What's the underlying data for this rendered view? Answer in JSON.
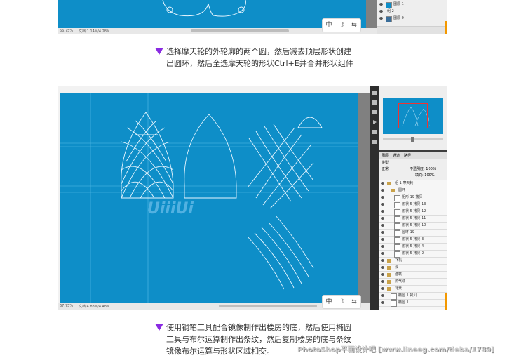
{
  "top_screenshot": {
    "status_left": "66.75%",
    "status_doc": "文档:1.14M/4.28M",
    "layers": [
      {
        "name": "图层 1"
      },
      {
        "name": "组 2"
      },
      {
        "name": "图层 0"
      }
    ],
    "tray": {
      "btn1": "中",
      "btn2": "☽",
      "btn3": "⇆"
    }
  },
  "caption1": {
    "line1": "选择摩天轮的外轮廓的两个圆，然后减去顶层形状创建",
    "line2": "出圆环，然后全选摩天轮的形状Ctrl+E并合并形状组件"
  },
  "bottom_screenshot": {
    "status_left": "67.75%",
    "status_doc": "文档:4.83M/4.48M",
    "canvas_logo": "UiiiUi",
    "panel_tabs": [
      "图层",
      "通道",
      "路径"
    ],
    "panel_kind": "类型",
    "panel_mode": "正常",
    "panel_opacity": "不透明度: 100%",
    "panel_fill": "填充: 100%",
    "layers": [
      {
        "name": "组 1 摩天轮"
      },
      {
        "name": "圆环"
      },
      {
        "name": "矩形 19 拷贝"
      },
      {
        "name": "形状 5 拷贝 13"
      },
      {
        "name": "形状 5 拷贝 12"
      },
      {
        "name": "形状 5 拷贝 11"
      },
      {
        "name": "形状 5 拷贝 10"
      },
      {
        "name": "圆环 19"
      },
      {
        "name": "形状 5 拷贝 3"
      },
      {
        "name": "形状 5 拷贝 4"
      },
      {
        "name": "形状 5 拷贝 2"
      },
      {
        "name": "飞机"
      },
      {
        "name": "云"
      },
      {
        "name": "建筑"
      },
      {
        "name": "热气球"
      },
      {
        "name": "背景"
      },
      {
        "name": "椭圆 1 拷贝"
      },
      {
        "name": "椭圆 1"
      }
    ],
    "tray": {
      "btn1": "中",
      "btn2": "☽",
      "btn3": "⇆"
    }
  },
  "caption2": {
    "line1": "使用钢笔工具配合镜像制作出楼房的底，然后使用椭圆",
    "line2": "工具与布尔运算制作出条纹，然后复制楼房的底与条纹",
    "line3": "镜像布尔运算与形状区域相交。"
  },
  "watermark": "PhotoShop平面设计吧 [www.lineeg.com/tieba/1789]",
  "colors": {
    "canvas_blue": "#0e8ec8",
    "accent_purple": "#8a2be2",
    "panel_gray": "#eeeeee"
  }
}
